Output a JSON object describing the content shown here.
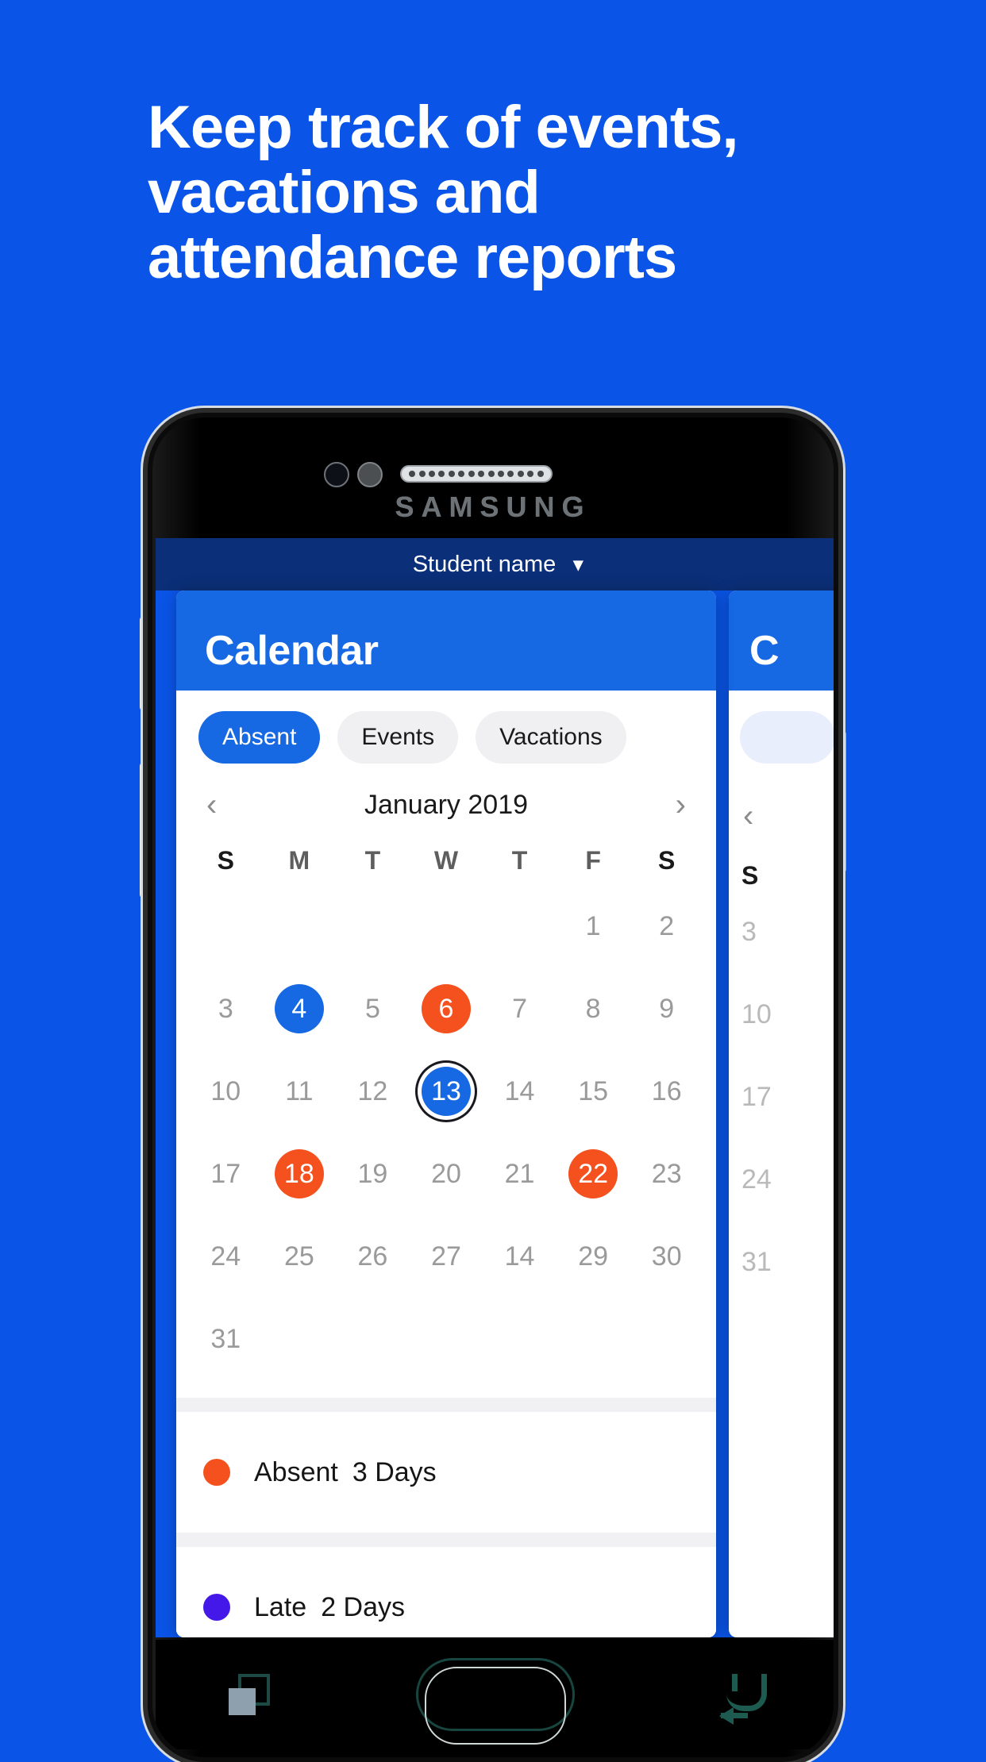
{
  "headline": {
    "line1": "Keep track of events,",
    "line2": "vacations and",
    "line3": "attendance reports"
  },
  "colors": {
    "background_blue": "#0a55e8",
    "header_navy": "#0b2f78",
    "card_blue": "#1668e3",
    "absent_orange": "#f4511e",
    "late_purple": "#4318e8"
  },
  "phone": {
    "brand": "SAMSUNG"
  },
  "app": {
    "statusbar": {
      "student_label": "Student name",
      "chevron": "⌄"
    },
    "card": {
      "title": "Calendar",
      "chips": [
        {
          "label": "Absent",
          "active": true
        },
        {
          "label": "Events",
          "active": false
        },
        {
          "label": "Vacations",
          "active": false
        }
      ],
      "month": {
        "prev": "‹",
        "label": "January 2019",
        "next": "›"
      },
      "weekdays": [
        "S",
        "M",
        "T",
        "W",
        "T",
        "F",
        "S"
      ],
      "days": [
        {
          "n": "",
          "state": "blank"
        },
        {
          "n": "",
          "state": "blank"
        },
        {
          "n": "",
          "state": "blank"
        },
        {
          "n": "",
          "state": "blank"
        },
        {
          "n": "",
          "state": "blank"
        },
        {
          "n": "1",
          "state": "plain"
        },
        {
          "n": "2",
          "state": "plain"
        },
        {
          "n": "3",
          "state": "plain"
        },
        {
          "n": "4",
          "state": "blue"
        },
        {
          "n": "5",
          "state": "plain"
        },
        {
          "n": "6",
          "state": "orange"
        },
        {
          "n": "7",
          "state": "plain"
        },
        {
          "n": "8",
          "state": "plain"
        },
        {
          "n": "9",
          "state": "plain"
        },
        {
          "n": "10",
          "state": "plain"
        },
        {
          "n": "11",
          "state": "plain"
        },
        {
          "n": "12",
          "state": "plain"
        },
        {
          "n": "13",
          "state": "today"
        },
        {
          "n": "14",
          "state": "plain"
        },
        {
          "n": "15",
          "state": "plain"
        },
        {
          "n": "16",
          "state": "plain"
        },
        {
          "n": "17",
          "state": "plain"
        },
        {
          "n": "18",
          "state": "orange"
        },
        {
          "n": "19",
          "state": "plain"
        },
        {
          "n": "20",
          "state": "plain"
        },
        {
          "n": "21",
          "state": "plain"
        },
        {
          "n": "22",
          "state": "orange"
        },
        {
          "n": "23",
          "state": "plain"
        },
        {
          "n": "24",
          "state": "plain"
        },
        {
          "n": "25",
          "state": "plain"
        },
        {
          "n": "26",
          "state": "plain"
        },
        {
          "n": "27",
          "state": "plain"
        },
        {
          "n": "14",
          "state": "plain"
        },
        {
          "n": "29",
          "state": "plain"
        },
        {
          "n": "30",
          "state": "plain"
        },
        {
          "n": "31",
          "state": "plain"
        },
        {
          "n": "",
          "state": "blank"
        },
        {
          "n": "",
          "state": "blank"
        },
        {
          "n": "",
          "state": "blank"
        },
        {
          "n": "",
          "state": "blank"
        },
        {
          "n": "",
          "state": "blank"
        },
        {
          "n": "",
          "state": "blank"
        }
      ],
      "legend": [
        {
          "label": "Absent",
          "count": "3 Days",
          "color": "orange"
        },
        {
          "label": "Late",
          "count": "2 Days",
          "color": "purple"
        }
      ]
    },
    "peek_card": {
      "title": "C",
      "prev": "‹",
      "weekday": "S",
      "column": [
        "3",
        "10",
        "17",
        "24",
        "31"
      ]
    }
  },
  "navbar": {
    "recent": "recent-apps",
    "home": "home",
    "back": "back"
  }
}
